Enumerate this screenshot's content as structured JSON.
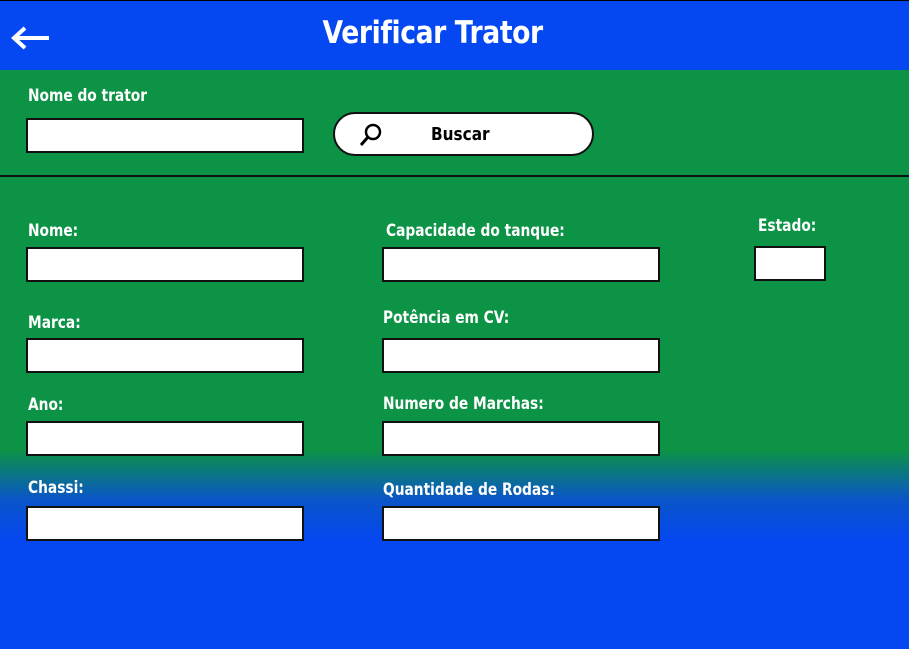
{
  "header": {
    "title": "Verificar Trator",
    "back_icon": "arrow-left-icon"
  },
  "search": {
    "label": "Nome do trator",
    "value": "",
    "button_label": "Buscar",
    "button_icon": "magnifier-icon"
  },
  "form": {
    "nome": {
      "label": "Nome:",
      "value": ""
    },
    "marca": {
      "label": "Marca:",
      "value": ""
    },
    "ano": {
      "label": "Ano:",
      "value": ""
    },
    "chassi": {
      "label": "Chassi:",
      "value": ""
    },
    "capacidade": {
      "label": "Capacidade do tanque:",
      "value": ""
    },
    "potencia": {
      "label": "Potência em CV:",
      "value": ""
    },
    "marchas": {
      "label": "Numero de Marchas:",
      "value": ""
    },
    "rodas": {
      "label": "Quantidade de Rodas:",
      "value": ""
    },
    "estado": {
      "label": "Estado:",
      "value": ""
    }
  },
  "colors": {
    "header_blue": "#0547f0",
    "panel_green": "#0c9346",
    "field_white": "#ffffff"
  }
}
